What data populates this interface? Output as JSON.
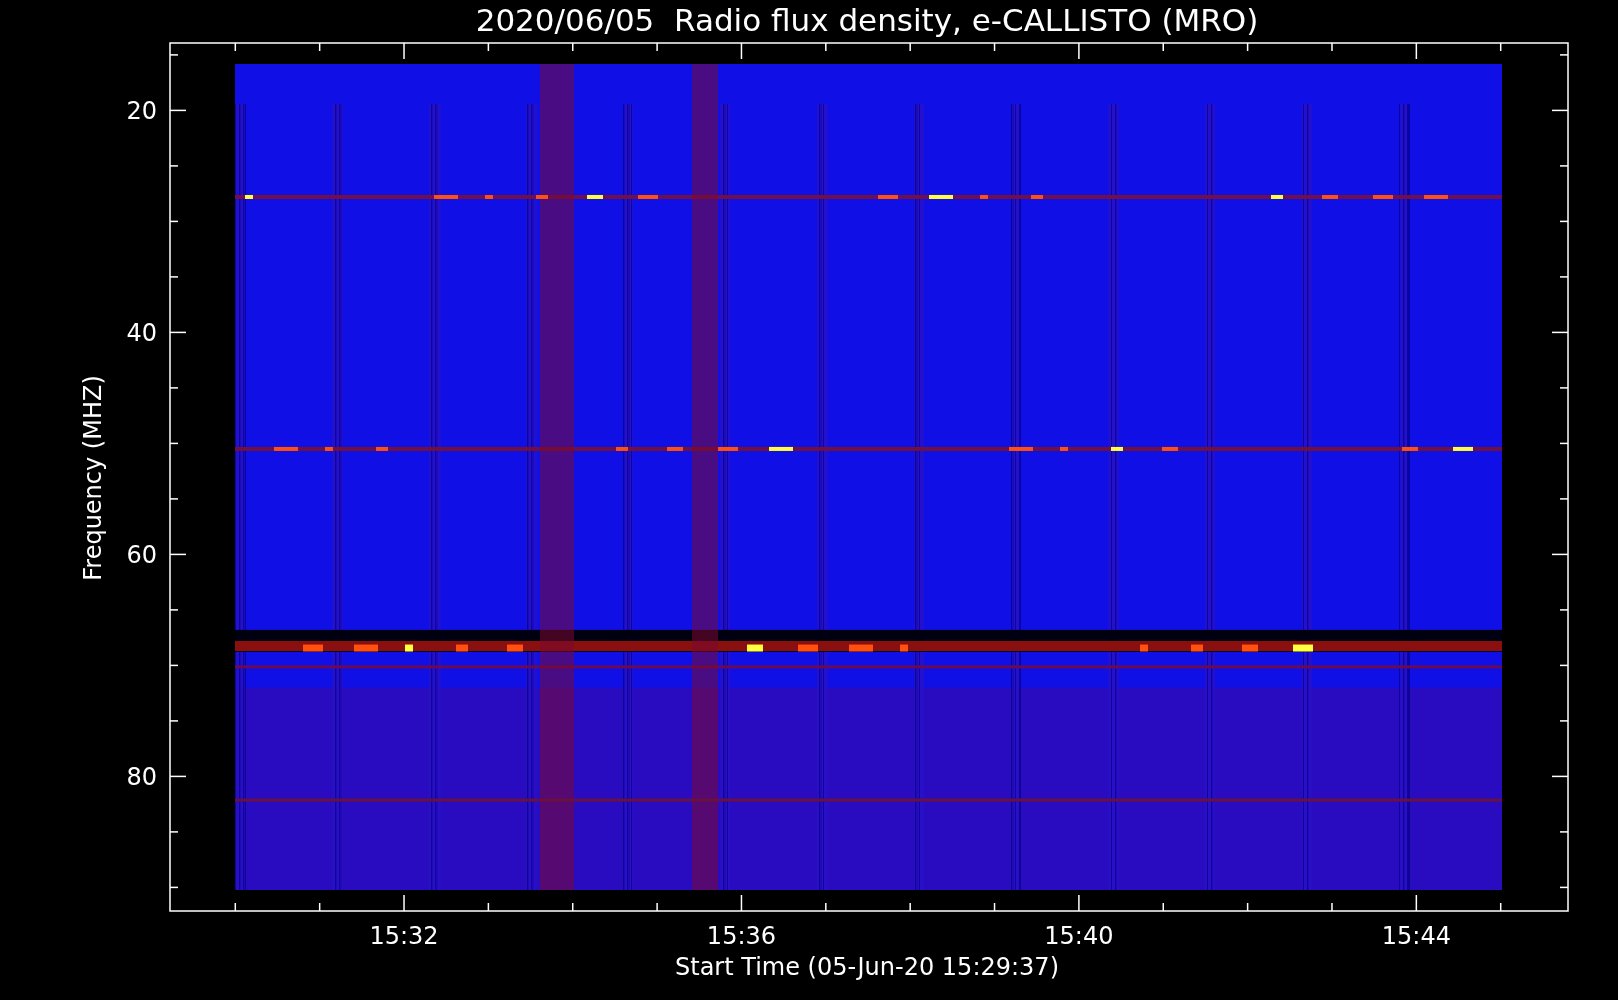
{
  "title": "2020/06/05  Radio flux density, e-CALLISTO (MRO)",
  "y_axis": {
    "label": "Frequency (MHZ)",
    "ticks": [
      "20",
      "40",
      "60",
      "80"
    ]
  },
  "x_axis": {
    "label": "Start Time (05-Jun-20 15:29:37)",
    "ticks": [
      "15:32",
      "15:36",
      "15:40",
      "15:44"
    ]
  }
}
